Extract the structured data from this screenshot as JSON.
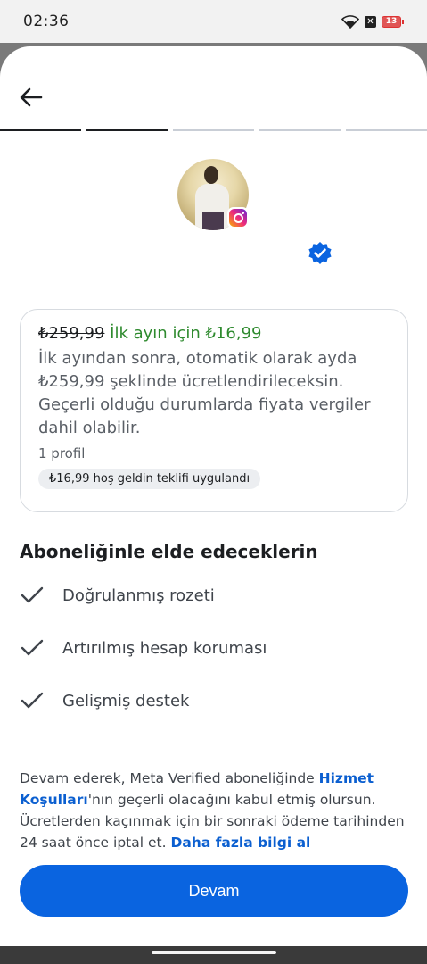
{
  "status_bar": {
    "time": "02:36",
    "battery": "13",
    "notification_icon": "x-icon"
  },
  "header": {
    "back_icon": "arrow-left-icon",
    "progress": {
      "total_steps": 5,
      "completed_steps": 2
    }
  },
  "profile": {
    "badge_icon": "instagram-icon",
    "verified_icon": "verified-badge-icon"
  },
  "pricing": {
    "old_price": "₺259,99",
    "promo": "İlk ayın için ₺16,99",
    "description": "İlk ayından sonra, otomatik olarak ayda ₺259,99 şeklinde ücretlendirileceksin. Geçerli olduğu durumlarda fiyata vergiler dahil olabilir.",
    "profile_count": "1 profil",
    "welcome_offer": "₺16,99 hoş geldin teklifi uygulandı"
  },
  "benefits": {
    "title": "Aboneliğinle elde edeceklerin",
    "items": [
      {
        "label": "Doğrulanmış rozeti",
        "icon": "check-icon"
      },
      {
        "label": "Artırılmış hesap koruması",
        "icon": "check-icon"
      },
      {
        "label": "Gelişmiş destek",
        "icon": "check-icon"
      }
    ]
  },
  "legal": {
    "part1": "Devam ederek, Meta Verified aboneliğinde ",
    "terms_link": "Hizmet Koşulları",
    "part2": "'nın geçerli olacağını kabul etmiş olursun. Ücretlerden kaçınmak için bir sonraki ödeme tarihinden 24 saat önce iptal et. ",
    "learn_more_link": "Daha fazla bilgi al"
  },
  "cta": {
    "label": "Devam"
  },
  "colors": {
    "primary": "#0a64e0",
    "promo_green": "#2e8a2e",
    "link_blue": "#0b5fd0"
  }
}
